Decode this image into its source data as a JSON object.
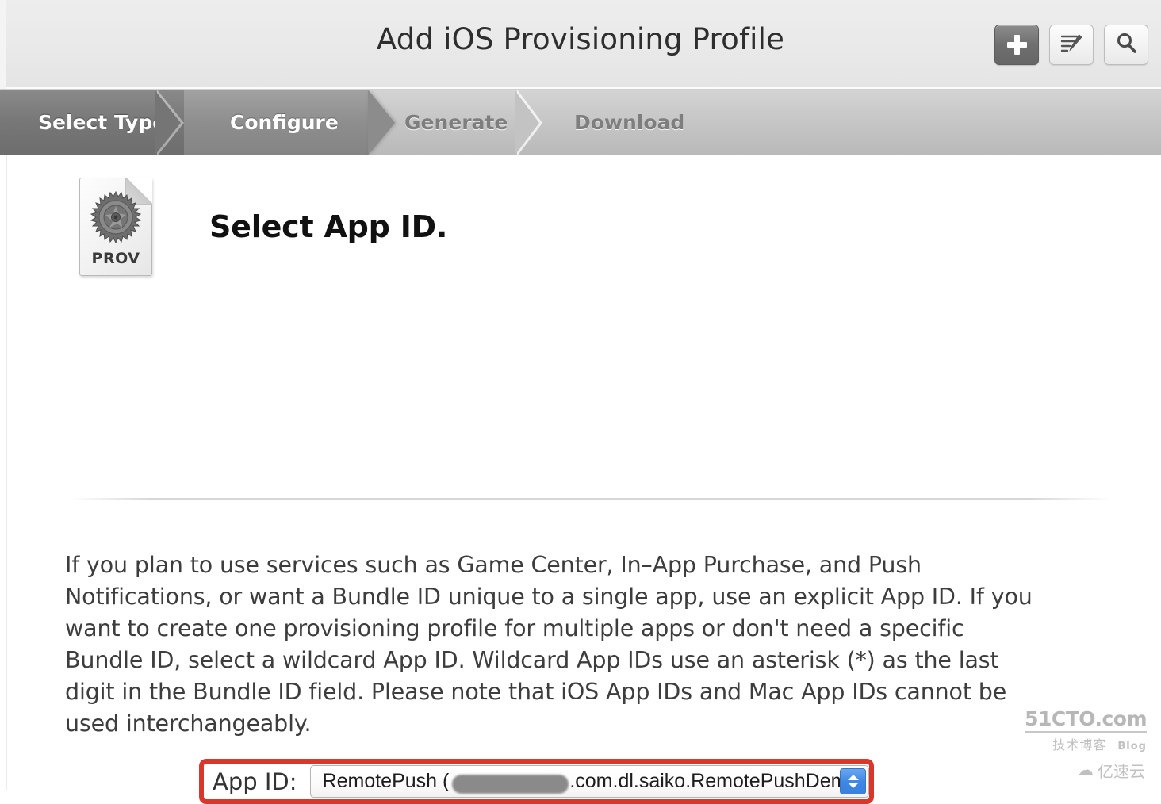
{
  "window": {
    "title": "Add iOS Provisioning Profile"
  },
  "toolbar": {
    "buttons": [
      {
        "name": "add-button",
        "icon": "plus-icon",
        "label": "+",
        "state": "active"
      },
      {
        "name": "edit-button",
        "icon": "edit-list-pencil-icon",
        "label": "",
        "state": "normal"
      },
      {
        "name": "search-button",
        "icon": "search-icon",
        "label": "",
        "state": "normal"
      }
    ]
  },
  "steps": [
    {
      "label": "Select Type",
      "state": "completed"
    },
    {
      "label": "Configure",
      "state": "active"
    },
    {
      "label": "Generate",
      "state": "inactive"
    },
    {
      "label": "Download",
      "state": "inactive"
    }
  ],
  "hero": {
    "icon": "provisioning-profile-document-icon",
    "icon_caption": "PROV",
    "title": "Select App ID."
  },
  "body": {
    "paragraph": "If you plan to use services such as Game Center, In–App Purchase, and Push Notifications, or want a Bundle ID unique to a single app, use an explicit App ID. If you want to create one provisioning profile for multiple apps or don't need a specific Bundle ID, select a wildcard App ID. Wildcard App IDs use an asterisk (*) as the last digit in the Bundle ID field. Please note that iOS App IDs and Mac App IDs cannot be used interchangeably."
  },
  "app_id_field": {
    "label": "App ID:",
    "selected_value_prefix": "RemotePush (",
    "selected_value_suffix": ".com.dl.saiko.RemotePushDemo)",
    "selected_value_redacted": true,
    "stepper_icon": "up-down-chevron-icon",
    "highlighted": true
  },
  "watermarks": {
    "primary": "51CTO.com",
    "primary_sub": "技术博客",
    "primary_blog": "Blog",
    "secondary": "亿速云",
    "secondary_icon": "cloud-icon"
  },
  "colors": {
    "highlight_red": "#d8372a",
    "stepper_blue": "#3f87e4",
    "step_active_gray": "#8e8e8e",
    "step_done_gray": "#777777",
    "titlebar_gray": "#e9e9e9"
  }
}
